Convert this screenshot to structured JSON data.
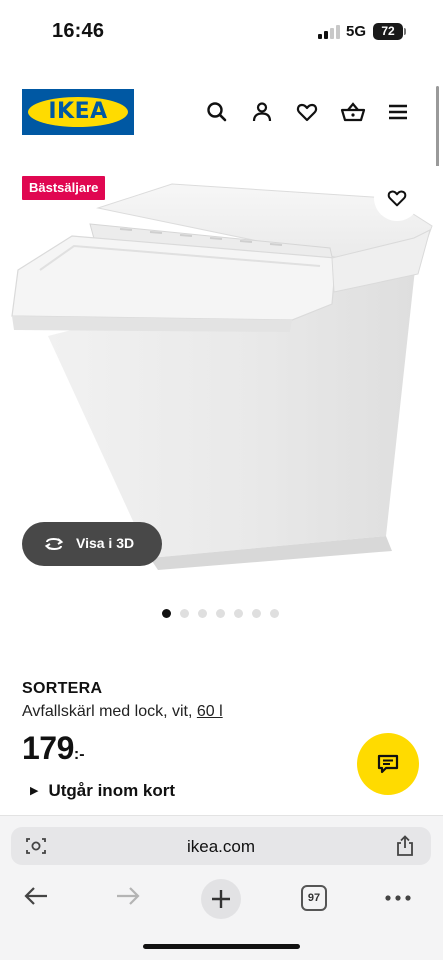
{
  "status_bar": {
    "time": "16:46",
    "network": "5G",
    "battery": "72"
  },
  "header": {
    "logo_text": "IKEA",
    "logo_colors": {
      "blue": "#0058a3",
      "yellow": "#ffdb00"
    },
    "icons": [
      "search-icon",
      "user-icon",
      "heart-icon",
      "basket-icon",
      "menu-icon"
    ]
  },
  "product": {
    "badge": "Bästsäljare",
    "badge_color": "#e00751",
    "view_3d_label": "Visa i 3D",
    "image_count": 7,
    "active_image": 1,
    "name": "SORTERA",
    "description": "Avfallskärl med lock, vit,",
    "size": "60 l",
    "price": "179",
    "price_suffix": ":-",
    "availability": "Utgår inom kort"
  },
  "browser": {
    "url": "ikea.com",
    "tab_count": "97"
  }
}
